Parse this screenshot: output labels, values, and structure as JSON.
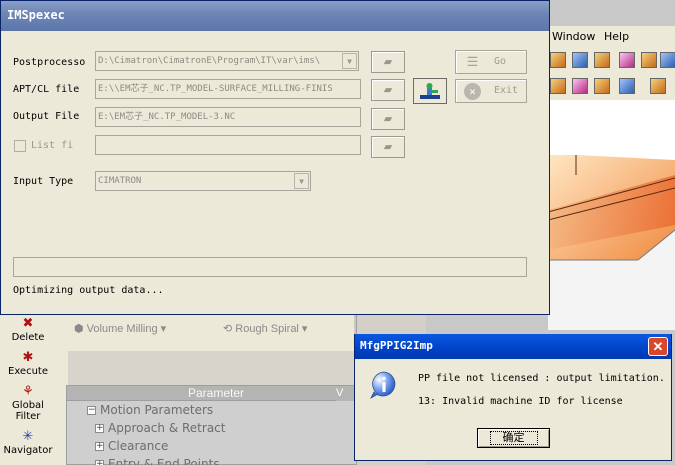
{
  "background_app": {
    "menu": [
      "Window",
      "Help"
    ],
    "left_tools": [
      "Delete",
      "Execute",
      "Global Filter",
      "Navigator"
    ],
    "procedure_type": "Volume Milling",
    "procedure_subtype": "Rough Spiral",
    "param_table": {
      "header": "Parameter",
      "value_header": "V",
      "rows": [
        "Motion Parameters",
        "Approach & Retract",
        "Clearance",
        "Entry & End Points"
      ]
    }
  },
  "ims_window": {
    "title": "IMSpexec",
    "labels": {
      "postprocessor": "Postprocesso",
      "apt_cl_file": "APT/CL file",
      "output_file": "Output File",
      "list_file": "List fi",
      "input_type": "Input Type"
    },
    "values": {
      "postprocessor": "D:\\Cimatron\\CimatronE\\Program\\IT\\var\\ims\\",
      "apt_cl_file": "E:\\\\EM芯子_NC.TP_MODEL-SURFACE_MILLING-FINIS",
      "output_file": "E:\\EM芯子_NC.TP_MODEL-3.NC",
      "list_file": "",
      "input_type": "CIMATRON"
    },
    "buttons": {
      "go": "Go",
      "exit": "Exit"
    },
    "status": "Optimizing output data..."
  },
  "mfg_dialog": {
    "title": "MfgPPIG2Imp",
    "line1": "PP file not licensed : output limitation.",
    "line2": "13: Invalid machine ID for license",
    "ok_label": "确定"
  }
}
